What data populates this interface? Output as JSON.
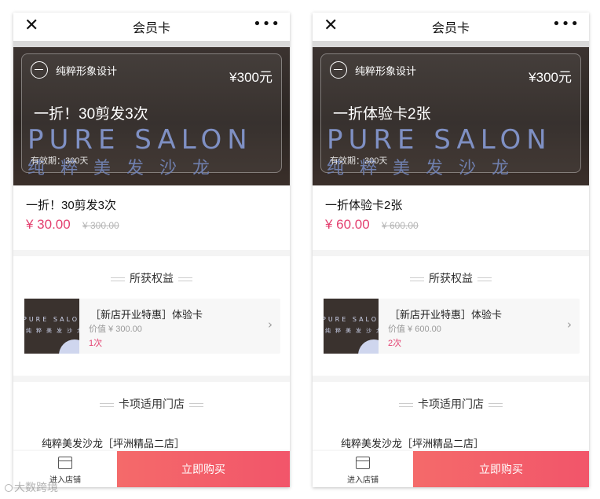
{
  "screens": [
    {
      "nav": {
        "title": "会员卡",
        "close_icon": "✕",
        "more_icon": "•••"
      },
      "card": {
        "brand": "纯粹形象设计",
        "price": "¥300元",
        "name": "一折！30剪发3次",
        "watermark_en": "PURE SALON",
        "watermark_cn": "纯粹美发沙龙",
        "validity": "有效期：300天"
      },
      "info": {
        "name": "一折！30剪发3次",
        "price": "¥ 30.00",
        "original_price": "¥ 300.00"
      },
      "benefits": {
        "title": "所获权益",
        "item": {
          "title": "［新店开业特惠］体验卡",
          "value": "价值 ¥ 300.00",
          "count": "1次",
          "thumb_en": "PURE SALON",
          "thumb_cn": "纯粹美发沙龙"
        }
      },
      "stores": {
        "title": "卡项适用门店",
        "name": "纯粹美发沙龙［坪洲精品二店］"
      },
      "bottom": {
        "store_label": "进入店铺",
        "buy_label": "立即购买"
      }
    },
    {
      "nav": {
        "title": "会员卡",
        "close_icon": "✕",
        "more_icon": "•••"
      },
      "card": {
        "brand": "纯粹形象设计",
        "price": "¥300元",
        "name": "一折体验卡2张",
        "watermark_en": "PURE SALON",
        "watermark_cn": "纯粹美发沙龙",
        "validity": "有效期：300天"
      },
      "info": {
        "name": "一折体验卡2张",
        "price": "¥ 60.00",
        "original_price": "¥ 600.00"
      },
      "benefits": {
        "title": "所获权益",
        "item": {
          "title": "［新店开业特惠］体验卡",
          "value": "价值 ¥ 600.00",
          "count": "2次",
          "thumb_en": "PURE SALON",
          "thumb_cn": "纯粹美发沙龙"
        }
      },
      "stores": {
        "title": "卡项适用门店",
        "name": "纯粹美发沙龙［坪洲精品二店］"
      },
      "bottom": {
        "store_label": "进入店铺",
        "buy_label": "立即购买"
      }
    }
  ],
  "chevron_icon": "›",
  "site_watermark": "大数跨境",
  "colors": {
    "accent": "#e33f6f",
    "buy_button": "#f2556a",
    "card_bg": "#2b2522"
  }
}
